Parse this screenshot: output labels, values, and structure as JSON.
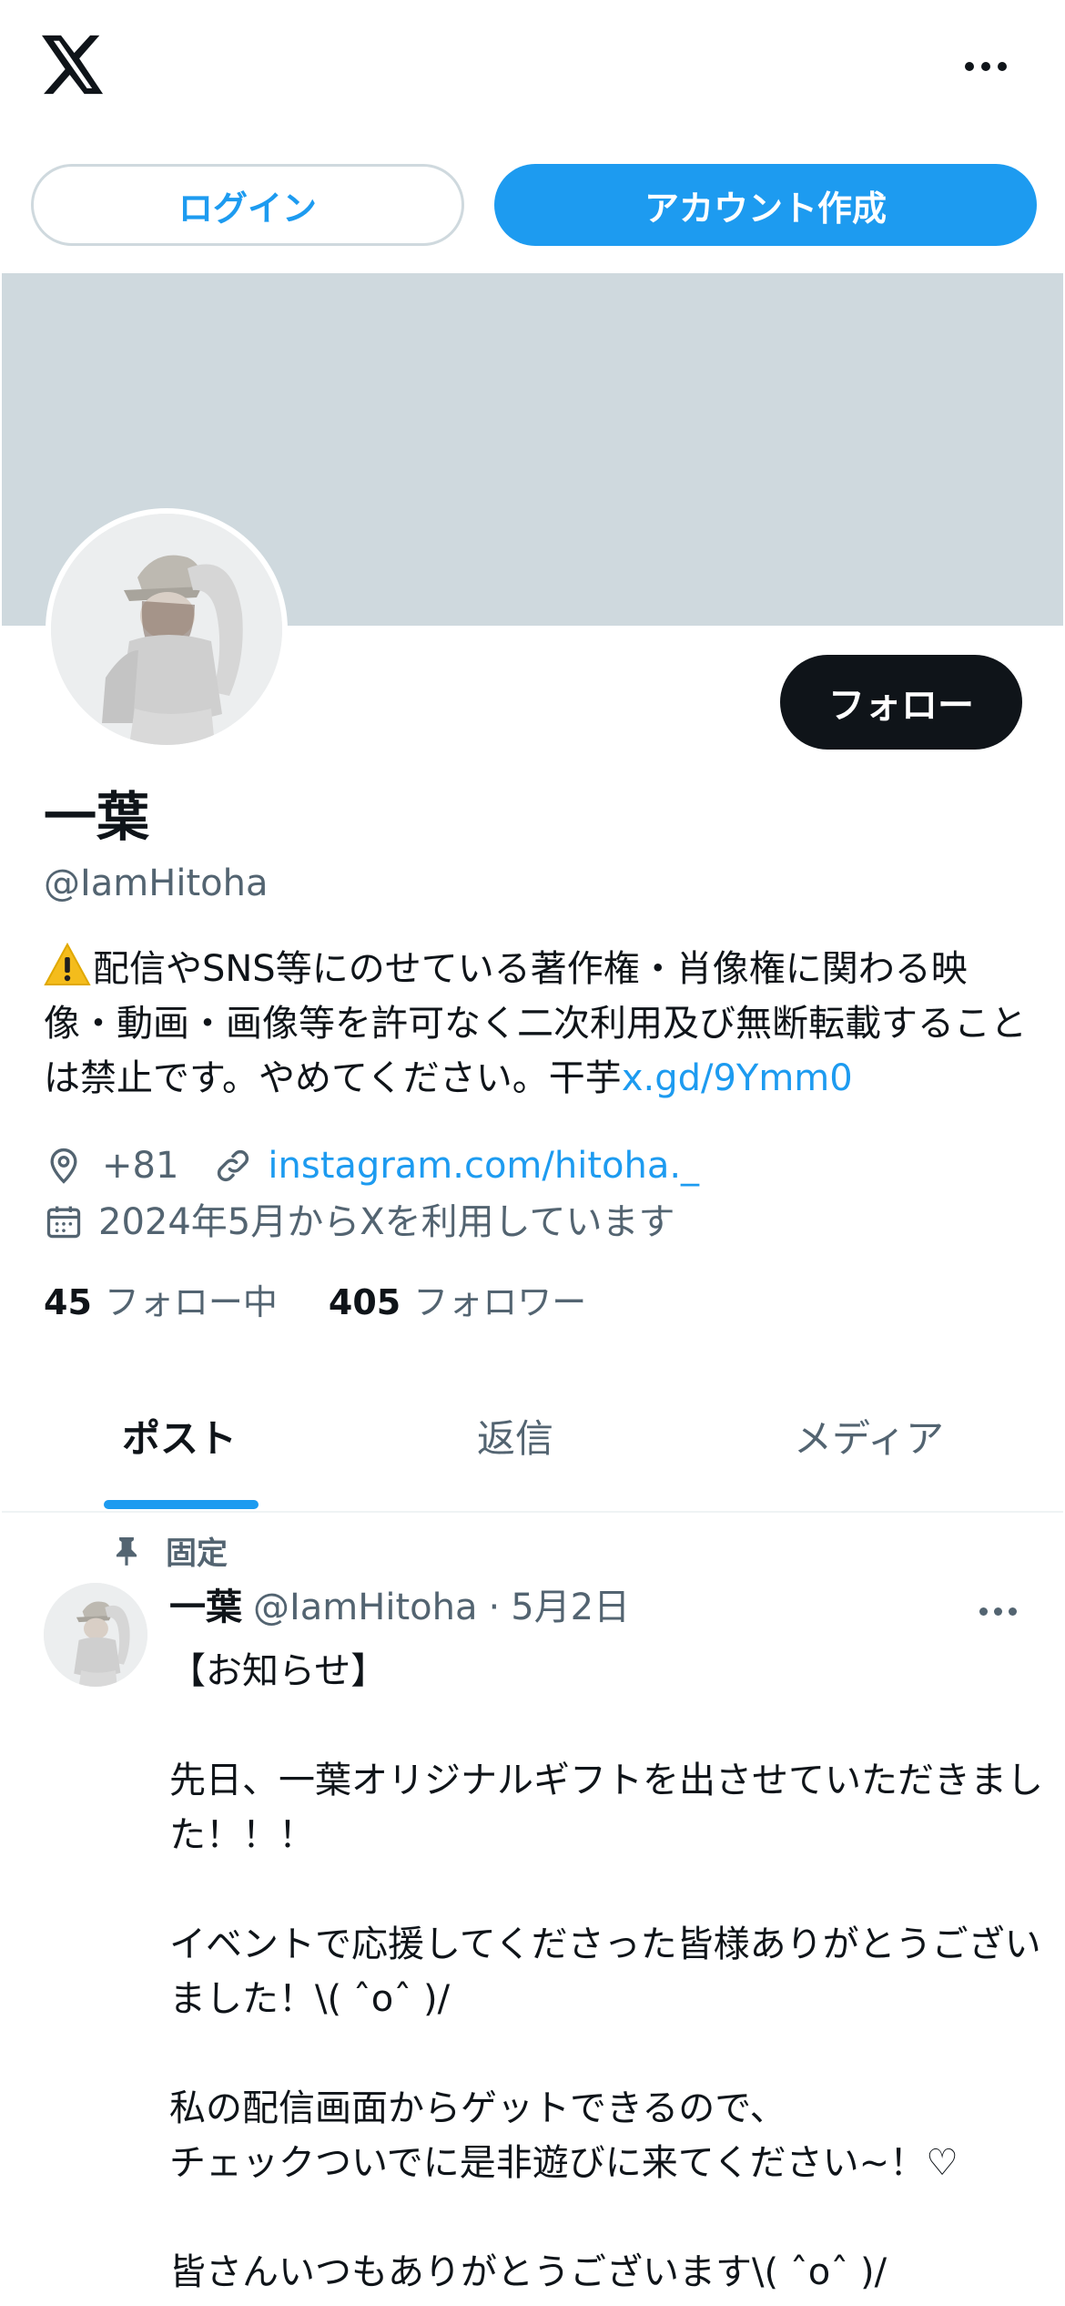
{
  "top": {
    "logo_icon": "x-logo",
    "more_icon": "more-horizontal-icon",
    "login_label": "ログイン",
    "signup_label": "アカウント作成"
  },
  "profile": {
    "name": "一葉",
    "handle": "@IamHitoha",
    "follow_label": "フォロー",
    "bio_text": "配信やSNS等にのせている著作権・肖像権に関わる映像・動画・画像等を許可なく二次利用及び無断転載することは禁止です。やめてください。干芋",
    "bio_link": "x.gd/9Ymm0",
    "location": "+81",
    "website": "instagram.com/hitoha._",
    "joined": "2024年5月からXを利用しています",
    "following_count": "45",
    "following_label": "フォロー中",
    "followers_count": "405",
    "followers_label": "フォロワー"
  },
  "tabs": [
    {
      "label": "ポスト",
      "active": true
    },
    {
      "label": "返信",
      "active": false
    },
    {
      "label": "メディア",
      "active": false
    }
  ],
  "pinned_tweet": {
    "pinned_label": "固定",
    "author_name": "一葉",
    "author_handle": "@IamHitoha",
    "separator": "·",
    "date": "5月2日",
    "lines": [
      "【お知らせ】",
      "",
      "先日、一葉オリジナルギフトを出させていただきました！！！",
      "",
      "イベントで応援してくださった皆様ありがとうございました！\\( ˆoˆ )/",
      "",
      "私の配信画面からゲットできるので、",
      "チェックついでに是非遊びに来てください~！♡",
      "",
      "皆さんいつもありがとうございます\\( ˆoˆ )/"
    ]
  },
  "colors": {
    "accent": "#1d9bf0",
    "banner": "#cfd9de",
    "text_primary": "#0f1419",
    "text_secondary": "#536471"
  }
}
